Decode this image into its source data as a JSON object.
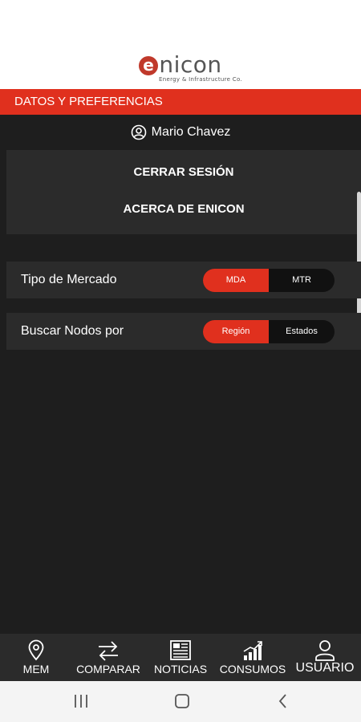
{
  "app": {
    "logo_text": "nicon",
    "logo_letter": "e",
    "logo_tagline": "Energy & Infrastructure Co.",
    "brand_color": "#e0301e"
  },
  "section": {
    "title": "DATOS Y PREFERENCIAS"
  },
  "user": {
    "name": "Mario Chavez",
    "icon": "user-circle-icon"
  },
  "menu": {
    "logout_label": "CERRAR SESIÓN",
    "about_label": "ACERCA DE ENICON"
  },
  "preferences": {
    "market": {
      "label": "Tipo de Mercado",
      "options": [
        "MDA",
        "MTR"
      ],
      "selected": "MDA"
    },
    "nodes": {
      "label": "Buscar Nodos por",
      "options": [
        "Región",
        "Estados"
      ],
      "selected": "Región"
    }
  },
  "bottom_nav": [
    {
      "label": "MEM",
      "icon": "map-pin-icon"
    },
    {
      "label": "COMPARAR",
      "icon": "swap-arrows-icon"
    },
    {
      "label": "NOTICIAS",
      "icon": "newspaper-icon"
    },
    {
      "label": "CONSUMOS",
      "icon": "bar-growth-icon"
    },
    {
      "label": "USUARIO",
      "icon": "person-icon"
    }
  ],
  "system_nav": {
    "recent": "recent-apps-icon",
    "home": "home-icon",
    "back": "back-icon"
  }
}
